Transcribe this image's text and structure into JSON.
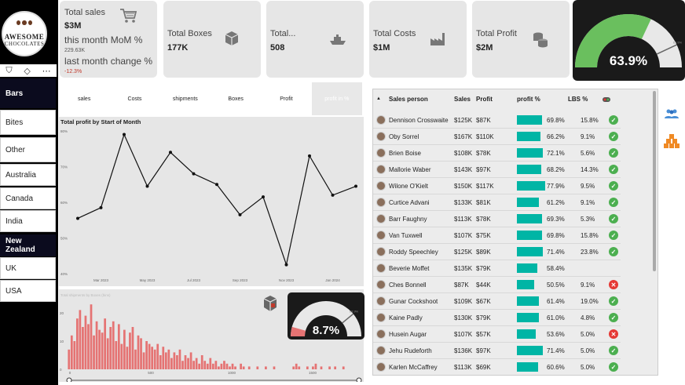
{
  "logo": {
    "line1": "AWESOME",
    "line2": "CHOCOLATES"
  },
  "toolbar": {
    "filter_icon": "filter-icon",
    "eraser_icon": "eraser-icon",
    "more_icon": "more-icon"
  },
  "slicers": [
    {
      "label": "Bars",
      "selected": true
    },
    {
      "label": "Bites",
      "selected": false
    },
    {
      "label": "Other",
      "selected": false
    },
    {
      "label": "Australia",
      "selected": false
    },
    {
      "label": "Canada",
      "selected": false
    },
    {
      "label": "India",
      "selected": false
    },
    {
      "label": "New Zealand",
      "selected": true
    },
    {
      "label": "UK",
      "selected": false
    },
    {
      "label": "USA",
      "selected": false
    }
  ],
  "cards": {
    "sales": {
      "label": "Total sales",
      "value": "$3M",
      "mom_label": "this month MoM %",
      "mom_value": "229.63K",
      "lm_label": "last month change %",
      "lm_value": "-12.3%"
    },
    "boxes": {
      "label": "Total Boxes",
      "value": "177K"
    },
    "shipments": {
      "label": "Total...",
      "value": "508"
    },
    "costs": {
      "label": "Total Costs",
      "value": "$1M"
    },
    "profit": {
      "label": "Total Profit",
      "value": "$2M"
    }
  },
  "gauge_main": {
    "value_text": "63.9%",
    "fraction": 0.639,
    "target_fraction": 0.86,
    "target_label": "63.9%",
    "color": "#6abf5e"
  },
  "tabs": [
    {
      "label": "sales",
      "active": false
    },
    {
      "label": "Costs",
      "active": false
    },
    {
      "label": "shipments",
      "active": false
    },
    {
      "label": "Boxes",
      "active": false
    },
    {
      "label": "Profit",
      "active": false
    },
    {
      "label": "profit in %",
      "active": true
    }
  ],
  "chart_data": [
    {
      "type": "line",
      "title": "Total profit by Start of Month",
      "x": [
        "Feb 2023",
        "Mar 2023",
        "Apr 2023",
        "May 2023",
        "Jun 2023",
        "Jul 2023",
        "Aug 2023",
        "Sep 2023",
        "Oct 2023",
        "Nov 2023",
        "Dec 2023",
        "Jan 2024",
        "Feb 2024"
      ],
      "x_tick_labels": [
        "Mar 2023",
        "May 2023",
        "Jul 2023",
        "Sep 2023",
        "Nov 2023",
        "Jan 2024"
      ],
      "values": [
        55.5,
        58.5,
        79,
        64.5,
        74,
        68,
        65,
        56.5,
        61.5,
        42.5,
        73,
        62,
        64.5
      ],
      "y_tick_labels": [
        "80%",
        "70%",
        "60%",
        "50%",
        "40%"
      ],
      "ylim": [
        40,
        80
      ],
      "grid": false
    },
    {
      "type": "bar",
      "title": "Total shipments by Boxes (bins)",
      "x_tick_labels": [
        "0",
        "500",
        "1000",
        "1500"
      ],
      "y_tick_labels": [
        "20",
        "10",
        "0"
      ],
      "ylim": [
        0,
        25
      ],
      "values": [
        7,
        12,
        10,
        18,
        21,
        15,
        19,
        16,
        23,
        12,
        17,
        14,
        13,
        18,
        11,
        15,
        17,
        10,
        16,
        9,
        14,
        8,
        13,
        15,
        7,
        12,
        11,
        6,
        10,
        9,
        8,
        7,
        9,
        5,
        8,
        6,
        7,
        4,
        6,
        5,
        7,
        3,
        5,
        4,
        6,
        3,
        4,
        2,
        5,
        3,
        2,
        4,
        2,
        3,
        1,
        2,
        3,
        2,
        1,
        2,
        1,
        0,
        2,
        1,
        0,
        1,
        0,
        0,
        1,
        0,
        0,
        1,
        0,
        0,
        1,
        0,
        0,
        0,
        0,
        0,
        0,
        1,
        2,
        1,
        0,
        0,
        1,
        0,
        1,
        2,
        0,
        1,
        0,
        0,
        1,
        0,
        1,
        0,
        0,
        1
      ]
    }
  ],
  "gauge_small": {
    "value_text": "8.7%",
    "fraction": 0.087,
    "target_fraction": 0.78,
    "target_label": "63.9%",
    "color": "#e57373"
  },
  "table": {
    "headers": {
      "name": "Sales person",
      "sales": "Sales",
      "profit": "Profit",
      "profit_pct": "profit %",
      "lbs": "LBS %"
    },
    "rows": [
      {
        "name": "Dennison Crosswaite",
        "sales": "$125K",
        "profit": "$87K",
        "pct": "69.8%",
        "frac": 0.698,
        "lbs": "15.8%",
        "status": "ok"
      },
      {
        "name": "Oby Sorrel",
        "sales": "$167K",
        "profit": "$110K",
        "pct": "66.2%",
        "frac": 0.662,
        "lbs": "9.1%",
        "status": "ok"
      },
      {
        "name": "Brien Boise",
        "sales": "$108K",
        "profit": "$78K",
        "pct": "72.1%",
        "frac": 0.721,
        "lbs": "5.6%",
        "status": "ok"
      },
      {
        "name": "Mallorie Waber",
        "sales": "$143K",
        "profit": "$97K",
        "pct": "68.2%",
        "frac": 0.682,
        "lbs": "14.3%",
        "status": "ok"
      },
      {
        "name": "Wilone O'Kielt",
        "sales": "$150K",
        "profit": "$117K",
        "pct": "77.9%",
        "frac": 0.779,
        "lbs": "9.5%",
        "status": "ok"
      },
      {
        "name": "Curtice Advani",
        "sales": "$133K",
        "profit": "$81K",
        "pct": "61.2%",
        "frac": 0.612,
        "lbs": "9.1%",
        "status": "ok"
      },
      {
        "name": "Barr Faughny",
        "sales": "$113K",
        "profit": "$78K",
        "pct": "69.3%",
        "frac": 0.693,
        "lbs": "5.3%",
        "status": "ok"
      },
      {
        "name": "Van Tuxwell",
        "sales": "$107K",
        "profit": "$75K",
        "pct": "69.8%",
        "frac": 0.698,
        "lbs": "15.8%",
        "status": "ok"
      },
      {
        "name": "Roddy Speechley",
        "sales": "$125K",
        "profit": "$89K",
        "pct": "71.4%",
        "frac": 0.714,
        "lbs": "23.8%",
        "status": "ok"
      },
      {
        "name": "Beverie Moffet",
        "sales": "$135K",
        "profit": "$79K",
        "pct": "58.4%",
        "frac": 0.584,
        "lbs": "",
        "status": ""
      },
      {
        "name": "Ches Bonnell",
        "sales": "$87K",
        "profit": "$44K",
        "pct": "50.5%",
        "frac": 0.505,
        "lbs": "9.1%",
        "status": "bad"
      },
      {
        "name": "Gunar Cockshoot",
        "sales": "$109K",
        "profit": "$67K",
        "pct": "61.4%",
        "frac": 0.614,
        "lbs": "19.0%",
        "status": "ok"
      },
      {
        "name": "Kaine Padly",
        "sales": "$130K",
        "profit": "$79K",
        "pct": "61.0%",
        "frac": 0.61,
        "lbs": "4.8%",
        "status": "ok"
      },
      {
        "name": "Husein Augar",
        "sales": "$107K",
        "profit": "$57K",
        "pct": "53.6%",
        "frac": 0.536,
        "lbs": "5.0%",
        "status": "bad"
      },
      {
        "name": "Jehu Rudeforth",
        "sales": "$136K",
        "profit": "$97K",
        "pct": "71.4%",
        "frac": 0.714,
        "lbs": "5.0%",
        "status": "ok"
      },
      {
        "name": "Karlen McCaffrey",
        "sales": "$113K",
        "profit": "$69K",
        "pct": "60.6%",
        "frac": 0.606,
        "lbs": "5.0%",
        "status": "ok"
      }
    ]
  },
  "side_icons": {
    "people": "people-icon",
    "boxes": "boxes-icon"
  },
  "colors": {
    "teal": "#00b5a5",
    "green": "#4caf50",
    "red": "#e53935",
    "bar_red": "#e57373",
    "dark": "#0b0b1e"
  }
}
